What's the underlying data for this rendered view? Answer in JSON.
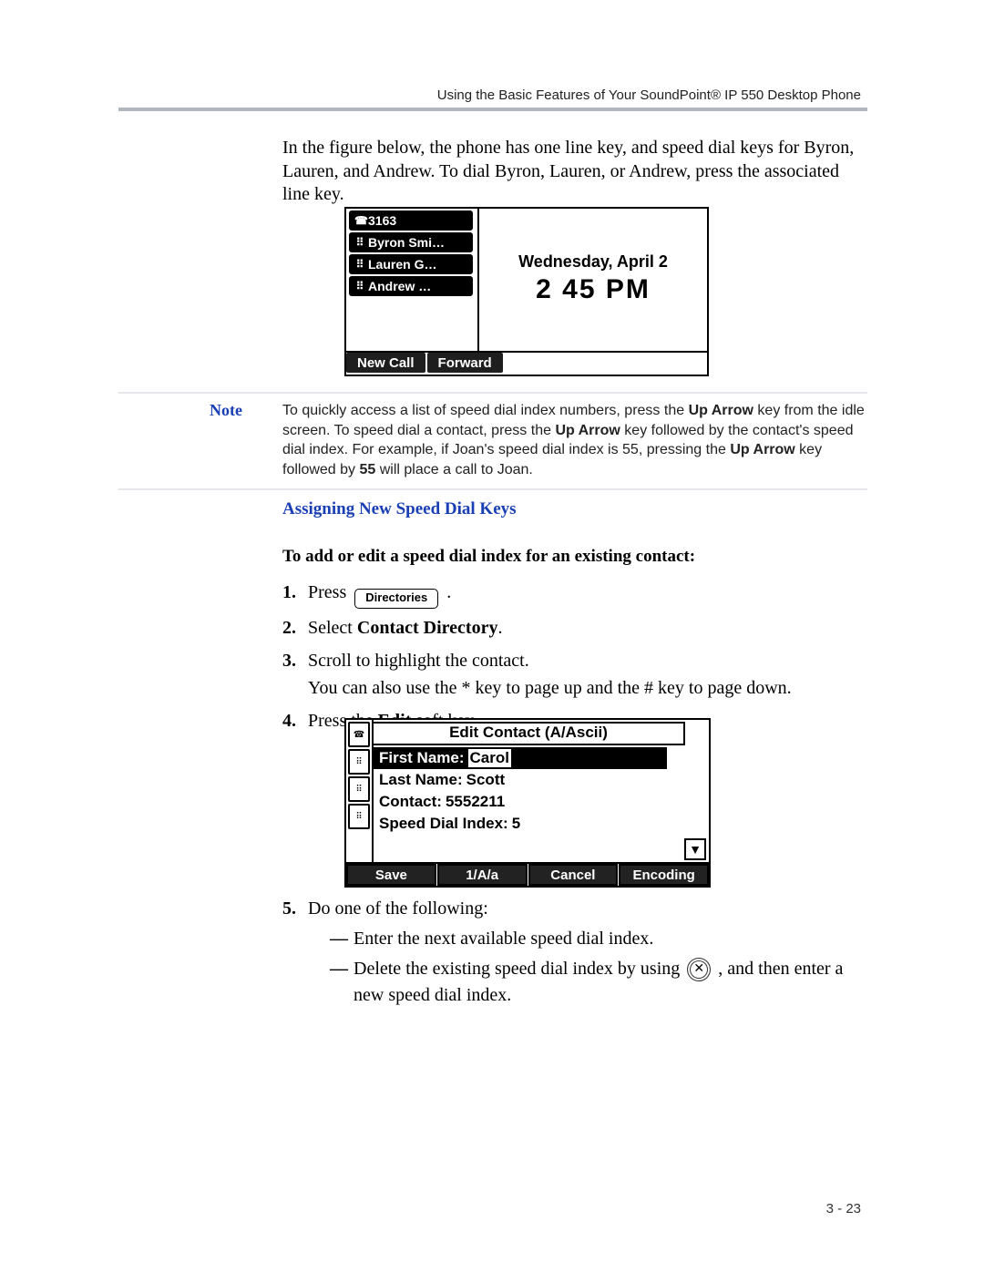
{
  "header": {
    "running_head": "Using the Basic Features of Your SoundPoint® IP 550 Desktop Phone"
  },
  "intro": "In the figure below, the phone has one line key, and speed dial keys for Byron, Lauren, and Andrew. To dial Byron, Lauren, or Andrew, press the associated line key.",
  "idle_screen": {
    "line_keys": [
      {
        "icon": "phone-icon",
        "label": "3163"
      },
      {
        "icon": "grid-icon",
        "label": "Byron Smi…"
      },
      {
        "icon": "grid-icon",
        "label": "Lauren G…"
      },
      {
        "icon": "grid-icon",
        "label": "Andrew …"
      }
    ],
    "date": "Wednesday, April 2",
    "time": "2 45 PM",
    "softkeys": [
      {
        "label": "New Call"
      },
      {
        "label": "Forward"
      }
    ]
  },
  "note": {
    "label": "Note",
    "text_before_1": "To quickly access a list of speed dial index numbers, press the ",
    "bold_1": "Up Arrow",
    "text_mid_1": " key from the idle screen. To speed dial a contact, press the ",
    "bold_2": "Up Arrow",
    "text_mid_2": " key followed by the contact's speed dial index. For example, if Joan's speed dial index is 55, pressing the ",
    "bold_3": "Up Arrow",
    "text_mid_3": " key followed by ",
    "bold_4": "55",
    "text_end": " will place a call to Joan."
  },
  "section_title": "Assigning New Speed Dial Keys",
  "lead_bold": "To add or edit a speed dial index for an existing contact:",
  "steps": {
    "s1_num": "1.",
    "s1_a": "Press ",
    "s1_button": "Directories",
    "s1_b": " .",
    "s2_num": "2.",
    "s2_a": "Select ",
    "s2_bold": "Contact Directory",
    "s2_b": ".",
    "s3_num": "3.",
    "s3_a": "Scroll to highlight the contact.",
    "s3_note": "You can also use the * key to page up and the # key to page down.",
    "s4_num": "4.",
    "s4_a": "Press the ",
    "s4_bold": "Edit",
    "s4_b": " soft key."
  },
  "edit_screen": {
    "title": "Edit Contact (A/Ascii)",
    "fields": [
      {
        "label": "First Name:",
        "value": "Carol",
        "selected": true
      },
      {
        "label": "Last Name:",
        "value": "Scott"
      },
      {
        "label": "Contact:",
        "value": "5552211"
      },
      {
        "label": "Speed Dial Index:",
        "value": "5"
      }
    ],
    "softkeys": [
      {
        "label": "Save"
      },
      {
        "label": "1/A/a"
      },
      {
        "label": "Cancel"
      },
      {
        "label": "Encoding"
      }
    ]
  },
  "step5": {
    "num": "5.",
    "lead": "Do one of the following:",
    "opt_a": "Enter the next available speed dial index.",
    "opt_b_before": "Delete the existing speed dial index by using ",
    "opt_b_after": ", and then enter a new speed dial index."
  },
  "footer": {
    "page": "3 - 23"
  }
}
